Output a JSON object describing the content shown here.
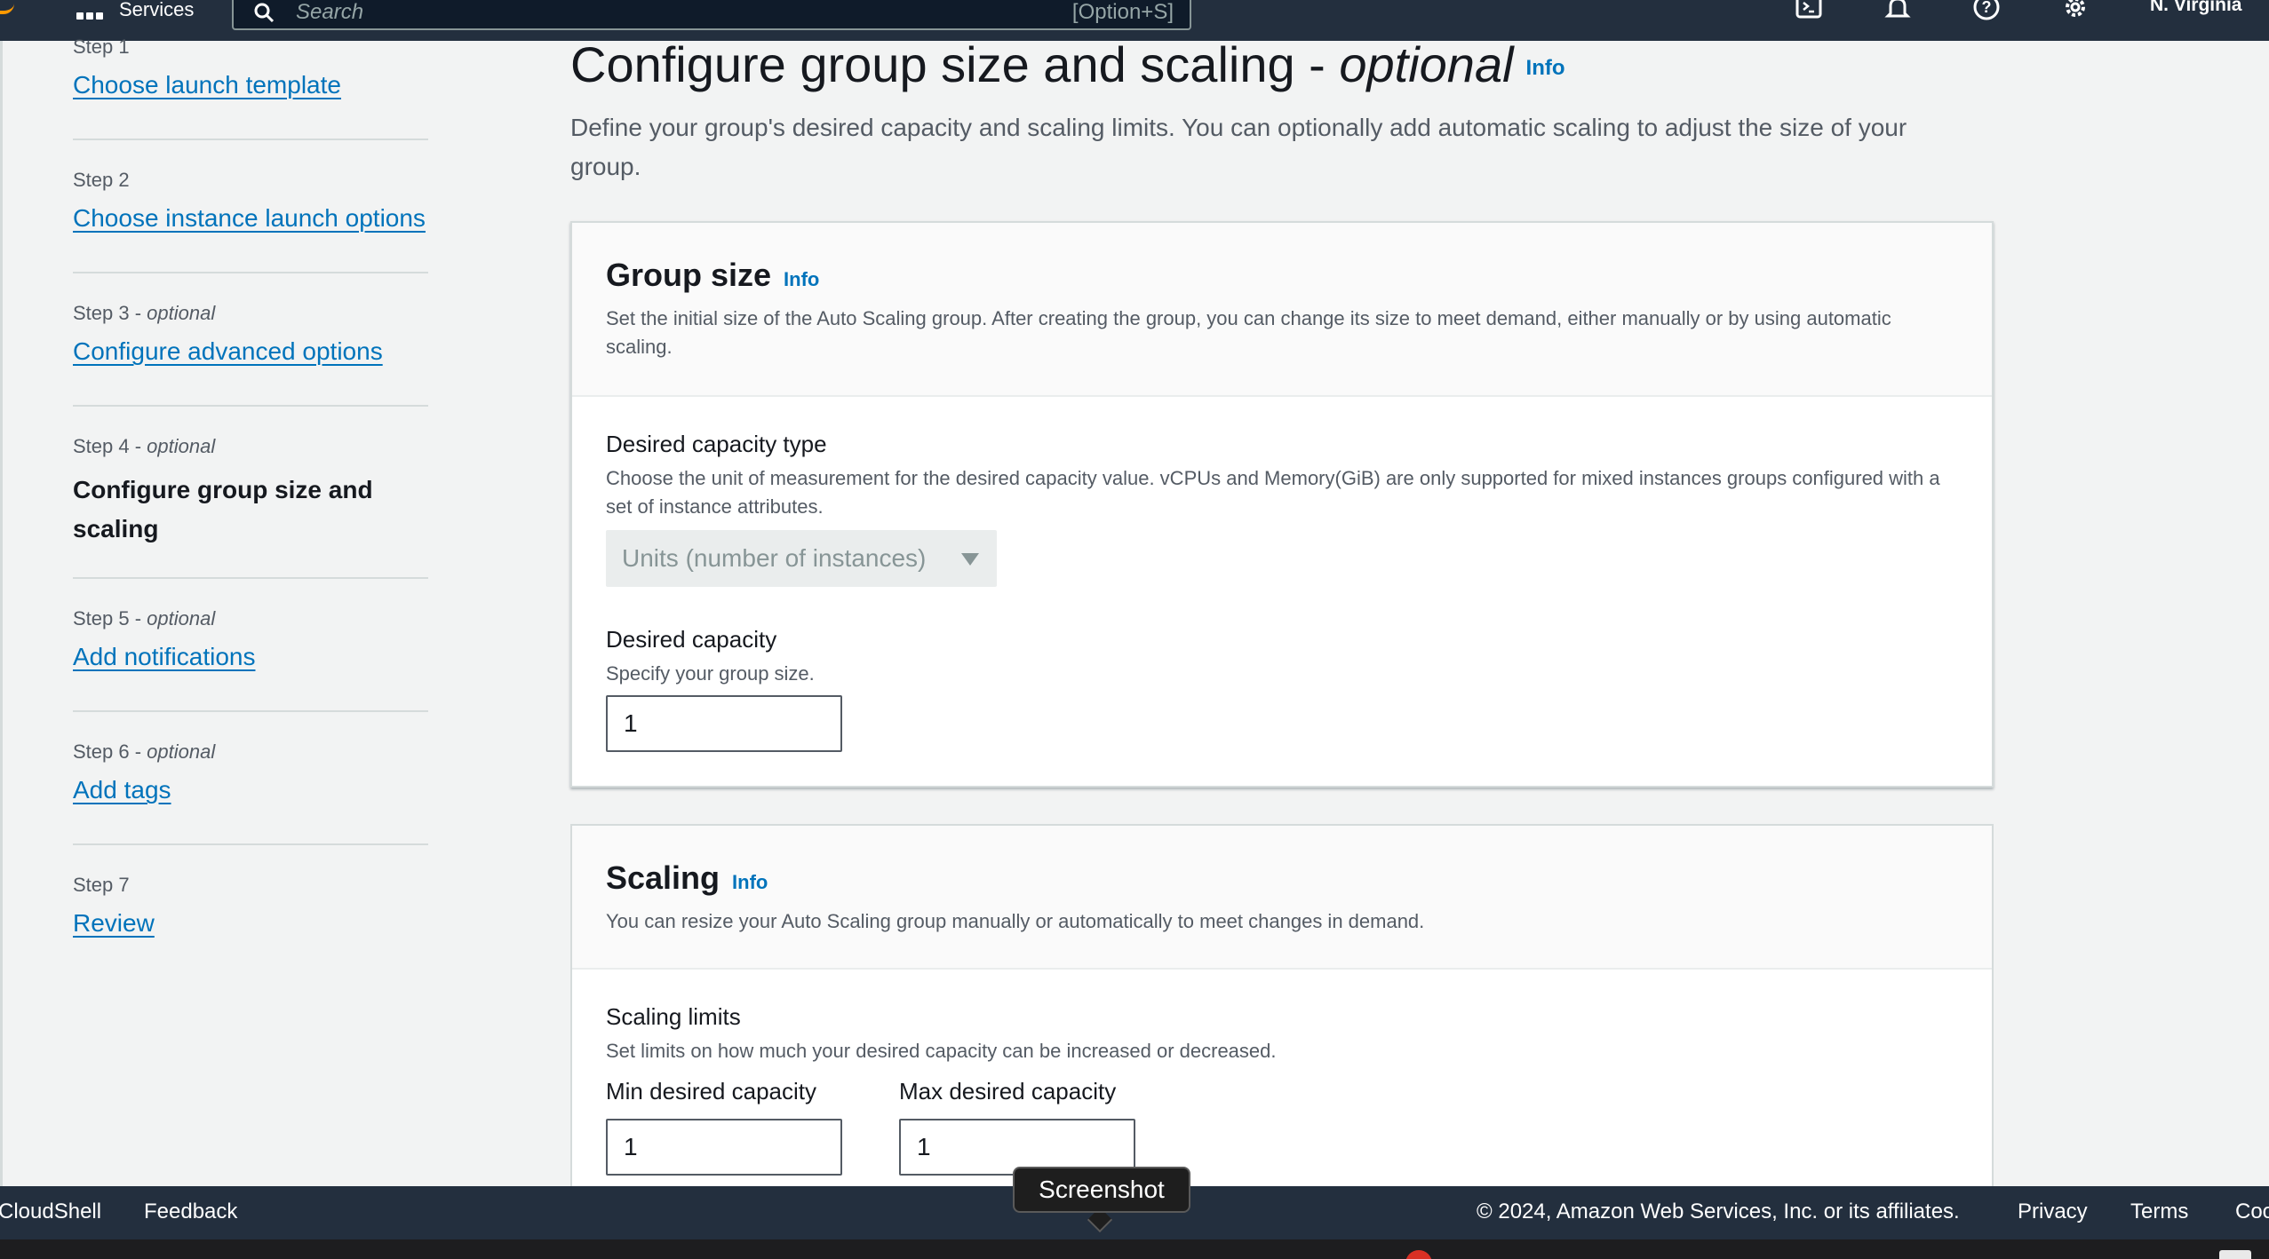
{
  "topbar": {
    "services_label": "Services",
    "search_placeholder": "Search",
    "search_shortcut": "[Option+S]",
    "region": "N. Virginia",
    "icons": [
      "cloudshell-icon",
      "notifications-icon",
      "help-icon",
      "settings-icon"
    ]
  },
  "steps": [
    {
      "num": "Step 1",
      "optional": "",
      "label": "Choose launch template",
      "current": false
    },
    {
      "num": "Step 2",
      "optional": "",
      "label": "Choose instance launch options",
      "current": false
    },
    {
      "num": "Step 3 - ",
      "optional": "optional",
      "label": "Configure advanced options",
      "current": false
    },
    {
      "num": "Step 4 - ",
      "optional": "optional",
      "label": "Configure group size and scaling",
      "current": true
    },
    {
      "num": "Step 5 - ",
      "optional": "optional",
      "label": "Add notifications",
      "current": false
    },
    {
      "num": "Step 6 - ",
      "optional": "optional",
      "label": "Add tags",
      "current": false
    },
    {
      "num": "Step 7",
      "optional": "",
      "label": "Review",
      "current": false
    }
  ],
  "page": {
    "title": "Configure group size and scaling - ",
    "title_optional": "optional",
    "info": "Info",
    "description": "Define your group's desired capacity and scaling limits. You can optionally add automatic scaling to adjust the size of your group."
  },
  "group_size": {
    "title": "Group size",
    "info": "Info",
    "description": "Set the initial size of the Auto Scaling group. After creating the group, you can change its size to meet demand, either manually or by using automatic scaling.",
    "capacity_type_label": "Desired capacity type",
    "capacity_type_desc": "Choose the unit of measurement for the desired capacity value. vCPUs and Memory(GiB) are only supported for mixed instances groups configured with a set of instance attributes.",
    "capacity_type_value": "Units (number of instances)",
    "desired_label": "Desired capacity",
    "desired_desc": "Specify your group size.",
    "desired_value": "1"
  },
  "scaling": {
    "title": "Scaling",
    "info": "Info",
    "description": "You can resize your Auto Scaling group manually or automatically to meet changes in demand.",
    "limits_label": "Scaling limits",
    "limits_desc": "Set limits on how much your desired capacity can be increased or decreased.",
    "min_label": "Min desired capacity",
    "min_value": "1",
    "max_label": "Max desired capacity",
    "max_value": "1"
  },
  "footer": {
    "cloudshell": "CloudShell",
    "feedback": "Feedback",
    "copyright": "© 2024, Amazon Web Services, Inc. or its affiliates.",
    "privacy": "Privacy",
    "terms": "Terms",
    "cookie": "Coo"
  },
  "tooltip": "Screenshot",
  "colors": {
    "nav_bg": "#232f3e",
    "link": "#0073bb",
    "page_bg": "#f2f3f3"
  }
}
